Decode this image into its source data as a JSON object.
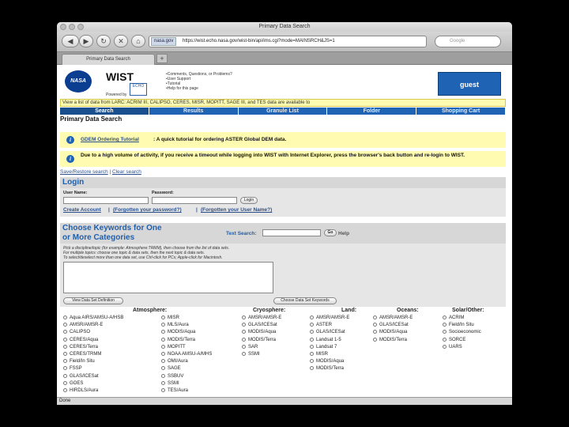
{
  "browser": {
    "window_title": "Primary Data Search",
    "url_site": "nasa.gov",
    "url": "https://wist.echo.nasa.gov/wist-bin/api/ims.cgi?mode=MAINSRCH&JS=1",
    "search_placeholder": "Google",
    "tab_label": "Primary Data Search",
    "new_tab": "+",
    "status": "Done",
    "back": "◀",
    "forward": "▶",
    "reload": "↻",
    "stop": "✕",
    "home": "⌂"
  },
  "header": {
    "nasa_logo": "NASA",
    "app_name": "WIST",
    "echo_badge": "ECHO",
    "powered_by": "Powered by",
    "links": [
      "•Comments, Questions, or Problems?",
      "•User Support",
      "•Tutorial",
      "•Help for this page"
    ],
    "user_box": "guest",
    "banner": "View a list of data from LARC: ACRIM III, CALIPSO, CERES, MISR, MOPITT, SAGE III, and TES data are available to"
  },
  "nav": {
    "tabs": [
      "Search",
      "Results",
      "Granule List",
      "Folder",
      "Shopping Cart"
    ],
    "active": 0
  },
  "page": {
    "title": "Primary Data Search",
    "note1_link": "GDEM Ordering Tutorial",
    "note1_text": ": A quick tutorial for ordering ASTER Global DEM data.",
    "note2_text": "Due to a high volume of activity, if you receive a timeout while logging into WIST with Internet Explorer, press the browser's back button and re-login to WIST.",
    "save_restore": "Save/Restore search",
    "clear_search": "Clear search",
    "sep": "|"
  },
  "login": {
    "title": "Login",
    "username_label": "User Name:",
    "password_label": "Password:",
    "login_button": "Login",
    "create_account": "Create Account",
    "forgot_password": "(Forgotten your password?)",
    "forgot_username": "(Forgotten your User Name?)"
  },
  "keywords": {
    "title_line1": "Choose Keywords for One",
    "title_line2": "or More Categories",
    "text_search_label": "Text Search:",
    "go_button": "Go",
    "help_link": "Help",
    "instr1": "Pick a discipline/topic (for example: Atmosphere:TRMM), then choose from the list of data sets.",
    "instr2": "For multiple topics: choose one topic & data sets, then the next topic & data sets.",
    "instr3": "To select/deselect more than one data set, use Ctrl-click for PCs; Apple-click for Macintosh.",
    "view_def_button": "View Data Set Definition",
    "choose_kw_button": "Choose Data Set Keywords",
    "columns": [
      {
        "title": "Atmosphere:",
        "items": [
          "Aqua AIRS/AMSU-A/HSB",
          "AMSR/AMSR-E",
          "CALIPSO",
          "CERES/Aqua",
          "CERES/Terra",
          "CERES/TRMM",
          "Field/In Situ",
          "FSSP",
          "GLAS/ICESat",
          "GOES",
          "HIRDLS/Aura"
        ]
      },
      {
        "title": "",
        "items": [
          "MISR",
          "MLS/Aura",
          "MODIS/Aqua",
          "MODIS/Terra",
          "MOPITT",
          "NOAA AMSU-A/MHS",
          "OMI/Aura",
          "SAGE",
          "SSBUV",
          "SSMI",
          "TES/Aura"
        ]
      },
      {
        "title": "Cryosphere:",
        "items": [
          "AMSR/AMSR-E",
          "GLAS/ICESat",
          "MODIS/Aqua",
          "MODIS/Terra",
          "SAR",
          "SSMI"
        ]
      },
      {
        "title": "Land:",
        "items": [
          "AMSR/AMSR-E",
          "ASTER",
          "GLAS/ICESat",
          "Landsat 1-5",
          "Landsat 7",
          "MISR",
          "MODIS/Aqua",
          "MODIS/Terra"
        ]
      },
      {
        "title": "Oceans:",
        "items": [
          "AMSR/AMSR-E",
          "GLAS/ICESat",
          "MODIS/Aqua",
          "MODIS/Terra"
        ]
      },
      {
        "title": "Solar/Other:",
        "items": [
          "ACRIM",
          "Field/In Situ",
          "Socioeconomic",
          "SORCE",
          "UARS"
        ]
      }
    ]
  }
}
